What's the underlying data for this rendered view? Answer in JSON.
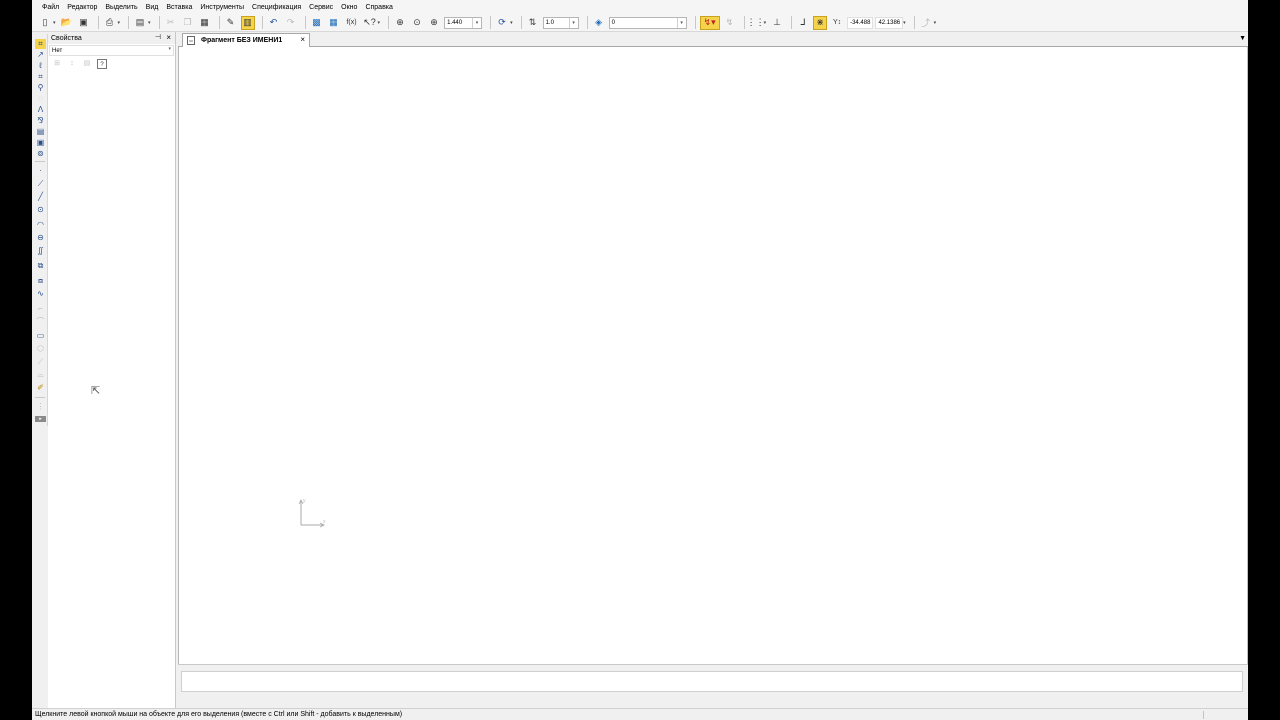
{
  "menubar": {
    "items": [
      {
        "label": "Файл",
        "name": "menu-file"
      },
      {
        "label": "Редактор",
        "name": "menu-editor"
      },
      {
        "label": "Выделить",
        "name": "menu-select"
      },
      {
        "label": "Вид",
        "name": "menu-view"
      },
      {
        "label": "Вставка",
        "name": "menu-insert"
      },
      {
        "label": "Инструменты",
        "name": "menu-tools"
      },
      {
        "label": "Спецификация",
        "name": "menu-specification"
      },
      {
        "label": "Сервис",
        "name": "menu-service"
      },
      {
        "label": "Окно",
        "name": "menu-window"
      },
      {
        "label": "Справка",
        "name": "menu-help"
      }
    ]
  },
  "toolbar": {
    "zoom_value": "1.440",
    "step_value": "1.0",
    "layer_value": "0",
    "coord_x": "-34.488",
    "coord_y": "42.1386",
    "fx_label": "f(x)",
    "highlight_color": "#f5d34a"
  },
  "properties": {
    "title": "Свойства",
    "pin_glyph": "⊣",
    "close_glyph": "×",
    "selection_value": "Нет"
  },
  "document": {
    "tab_title": "Фрагмент БЕЗ ИМЕНИ1",
    "tab_close": "×",
    "axis_x_label": "x",
    "axis_y_label": "y"
  },
  "statusbar": {
    "message": "Щелкните левой кнопкой мыши на объекте для его выделения (вместе с Ctrl или Shift - добавить к выделенным)"
  }
}
